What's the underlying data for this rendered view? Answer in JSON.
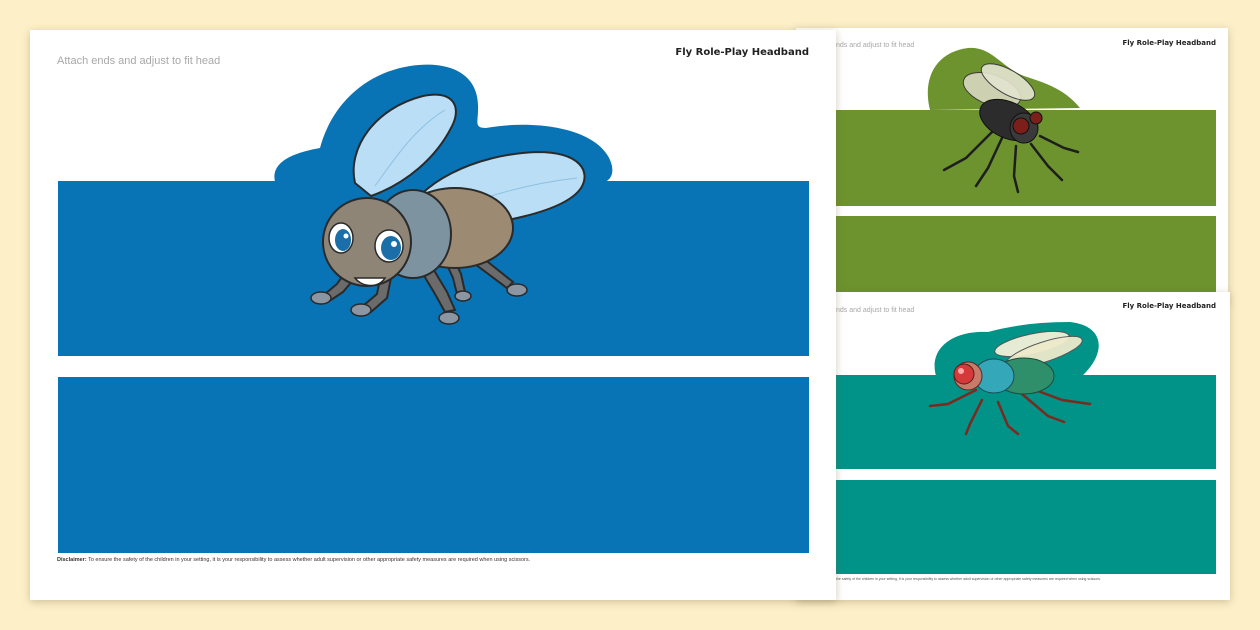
{
  "colors": {
    "background": "#fdf0c9",
    "blue_band": "#0873b5",
    "green_band": "#6c932d",
    "teal_band": "#019388"
  },
  "main_sheet": {
    "title": "Fly Role-Play Headband",
    "instruction": "Attach ends and adjust to fit head",
    "disclaimer_label": "Disclaimer:",
    "disclaimer_text": " To ensure the safety of the children in your setting, it is your responsibility to assess whether adult supervision or other appropriate safety measures are required when using scissors."
  },
  "green_sheet": {
    "title": "Fly Role-Play Headband",
    "instruction": "nds and adjust to fit head"
  },
  "teal_sheet": {
    "title": "Fly Role-Play Headband",
    "instruction": "nds and adjust to fit head",
    "disclaimer_text": "the safety of the children in your setting, it is your responsibility to assess whether adult supervision or other appropriate safety measures are required when using scissors."
  }
}
